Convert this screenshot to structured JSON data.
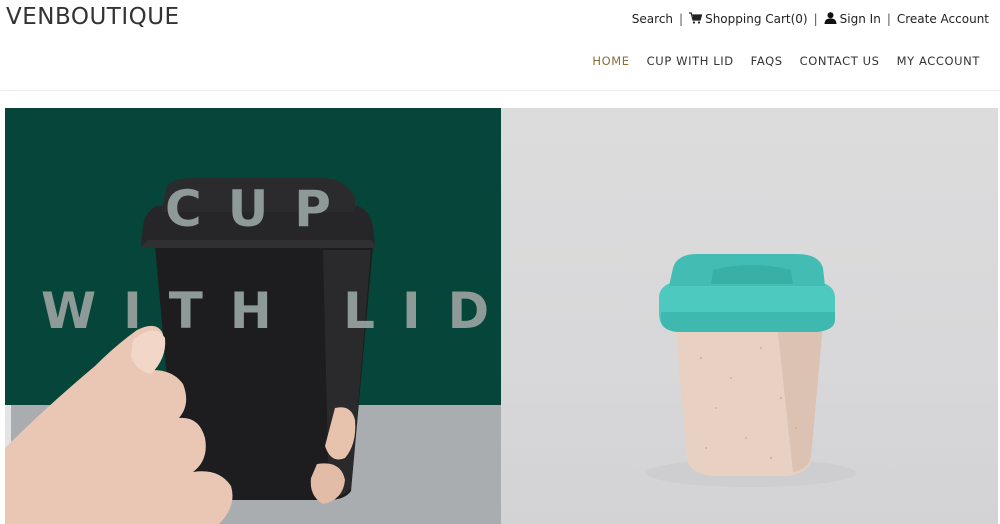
{
  "brand": {
    "logo": "VENBOUTIQUE"
  },
  "utility": {
    "search": "Search",
    "cart": "Shopping Cart(0)",
    "sign_in": "Sign In",
    "create_account": "Create Account",
    "separator": "|"
  },
  "nav": {
    "items": [
      {
        "label": "HOME"
      },
      {
        "label": "CUP WITH LID"
      },
      {
        "label": "FAQS"
      },
      {
        "label": "CONTACT US"
      },
      {
        "label": "MY ACCOUNT"
      }
    ]
  },
  "hero": {
    "line1": "CUP",
    "line2": "WITH LID"
  },
  "colors": {
    "brand_green": "#06463a",
    "nav_active": "#8a6d3b",
    "lid_teal": "#4ec9bf"
  }
}
